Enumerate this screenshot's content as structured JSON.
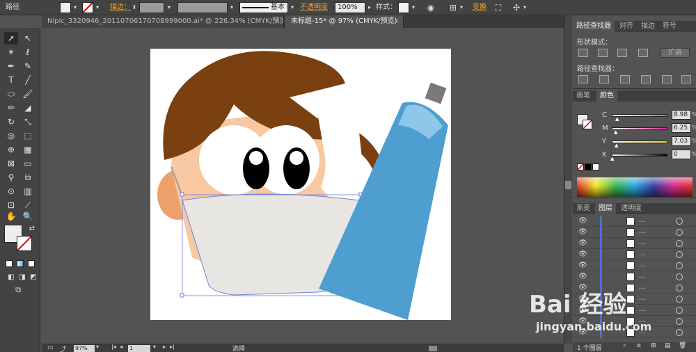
{
  "control_bar": {
    "path_label": "路径",
    "stroke_label": "描边：",
    "stroke_style": "基本",
    "opacity_label": "不透明度",
    "opacity_value": "100%",
    "style_label": "样式：",
    "transform_label": "变换"
  },
  "tabs": [
    {
      "label": "Nipic_3320946_20110706170708999000.ai* @ 226.34% (CMYK/预览)",
      "close": "×"
    },
    {
      "label": "未标题-15* @ 97% (CMYK/预览)",
      "close": "×"
    }
  ],
  "status_bar": {
    "zoom": "97%",
    "page": "1",
    "mode": "选择"
  },
  "pathfinder_panel": {
    "tabs": [
      "路径查找器",
      "对齐",
      "描边",
      "符号"
    ],
    "shape_modes_label": "形状模式：",
    "expand_button": "扩展",
    "pathfinders_label": "路径查找器："
  },
  "color_panel": {
    "tabs": [
      "画笔",
      "颜色"
    ],
    "channels": [
      {
        "label": "C",
        "value": "8.98",
        "unit": "%",
        "fraction": 0.09,
        "color": "#27a9c6"
      },
      {
        "label": "M",
        "value": "6.25",
        "unit": "%",
        "fraction": 0.06,
        "color": "#d12a8f"
      },
      {
        "label": "Y",
        "value": "7.03",
        "unit": "%",
        "fraction": 0.07,
        "color": "#e8e127"
      },
      {
        "label": "K",
        "value": "0",
        "unit": "%",
        "fraction": 0.0,
        "color": "#000000"
      }
    ]
  },
  "layers_panel": {
    "tabs": [
      "渐变",
      "图层",
      "透明度"
    ],
    "rows": [
      {
        "name": "..."
      },
      {
        "name": "..."
      },
      {
        "name": "..."
      },
      {
        "name": "..."
      },
      {
        "name": "..."
      },
      {
        "name": "..."
      },
      {
        "name": "..."
      },
      {
        "name": "..."
      },
      {
        "name": "..."
      },
      {
        "name": "..."
      },
      {
        "name": "..."
      }
    ],
    "footer_label": "1 个图层"
  },
  "watermark": {
    "logo": "Bai  经验",
    "url": "jingyan.baidu.com"
  },
  "colors": {
    "hair": "#7a4010",
    "skin": "#f7c8a1",
    "mask": "#e8e6e3",
    "tube": "#4e9fd0",
    "cap": "#7d7878",
    "selection": "#6f7fd6"
  }
}
